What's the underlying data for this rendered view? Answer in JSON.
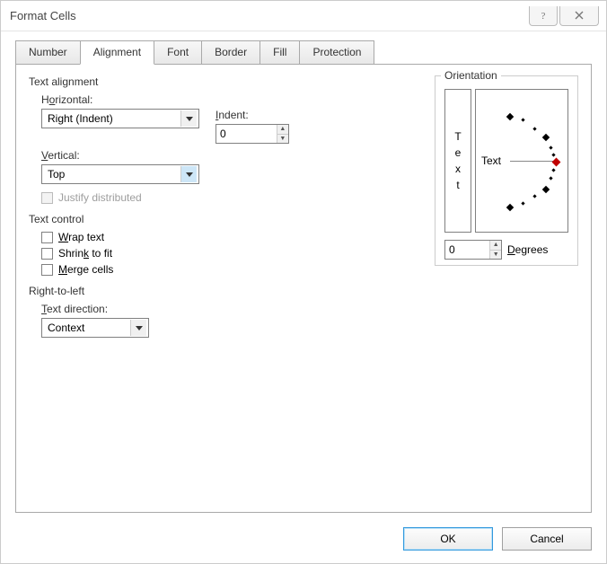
{
  "window": {
    "title": "Format Cells"
  },
  "tabs": {
    "number": "Number",
    "alignment": "Alignment",
    "font": "Font",
    "border": "Border",
    "fill": "Fill",
    "protection": "Protection"
  },
  "textAlignment": {
    "section": "Text alignment",
    "horizontalLabelPre": "H",
    "horizontalLabelU": "o",
    "horizontalLabelPost": "rizontal:",
    "horizontalValue": "Right (Indent)",
    "indentLabelU": "I",
    "indentLabelPost": "ndent:",
    "indentValue": "0",
    "verticalLabelU": "V",
    "verticalLabelPost": "ertical:",
    "verticalValue": "Top",
    "justifyDistributed": "Justify distributed"
  },
  "textControl": {
    "section": "Text control",
    "wrapU": "W",
    "wrapPost": "rap text",
    "shrinkPre": "Shrin",
    "shrinkU": "k",
    "shrinkPost": " to fit",
    "mergeU": "M",
    "mergePost": "erge cells"
  },
  "rtl": {
    "section": "Right-to-left",
    "textDirU": "T",
    "textDirPost": "ext direction:",
    "textDirValue": "Context"
  },
  "orientation": {
    "section": "Orientation",
    "vertical": {
      "c1": "T",
      "c2": "e",
      "c3": "x",
      "c4": "t"
    },
    "dialLabel": "Text",
    "degreesValue": "0",
    "degreesLabelU": "D",
    "degreesLabelPost": "egrees"
  },
  "buttons": {
    "ok": "OK",
    "cancel": "Cancel"
  }
}
